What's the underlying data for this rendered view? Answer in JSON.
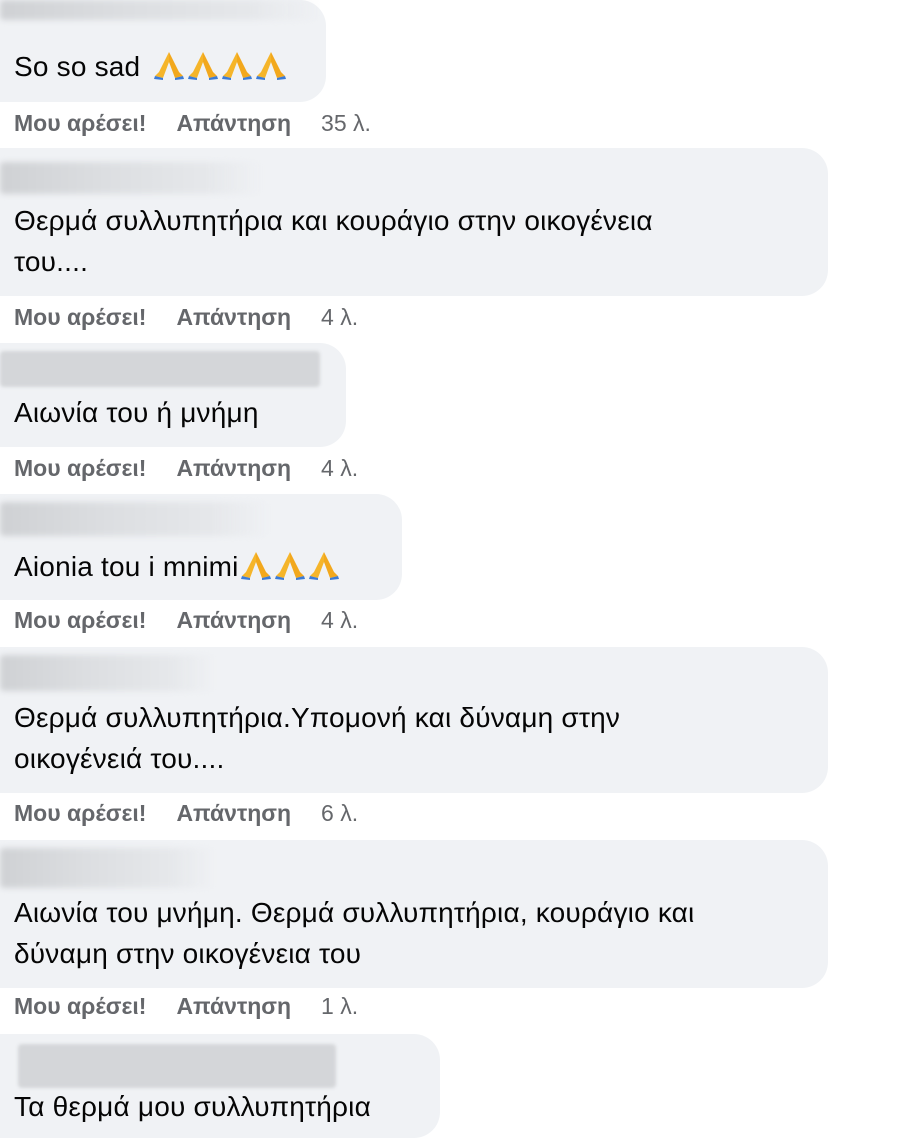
{
  "actions": {
    "like": "Μου αρέσει!",
    "reply": "Απάντηση"
  },
  "comments": [
    {
      "text_lines": [
        "So so sad"
      ],
      "emoji": "pray-icon",
      "emoji_count": 4,
      "time": "35 λ."
    },
    {
      "text_lines": [
        "Θερμά συλλυπητήρια και κουράγιο στην οικογένεια",
        "του...."
      ],
      "time": "4 λ."
    },
    {
      "text_lines": [
        "Αιωνία του ή μνήμη"
      ],
      "time": "4 λ."
    },
    {
      "text_lines": [
        "Aionia tou i mnimi"
      ],
      "emoji": "pray-icon",
      "emoji_count": 3,
      "time": "4 λ."
    },
    {
      "text_lines": [
        "Θερμά συλλυπητήρια.Υπομονή και δύναμη στην",
        "οικογένειά του...."
      ],
      "time": "6 λ."
    },
    {
      "text_lines": [
        "Αιωνία του μνήμη. Θερμά συλλυπητήρια, κουράγιο και",
        "δύναμη στην οικογένεια του"
      ],
      "time": "1 λ."
    },
    {
      "text_lines": [
        "Τα θερμά μου συλλυπητήρια"
      ]
    }
  ],
  "colors": {
    "bubble": "#f0f2f5",
    "action_text": "#65676b",
    "comment_text": "#050505",
    "emoji": "#f5b52a"
  }
}
